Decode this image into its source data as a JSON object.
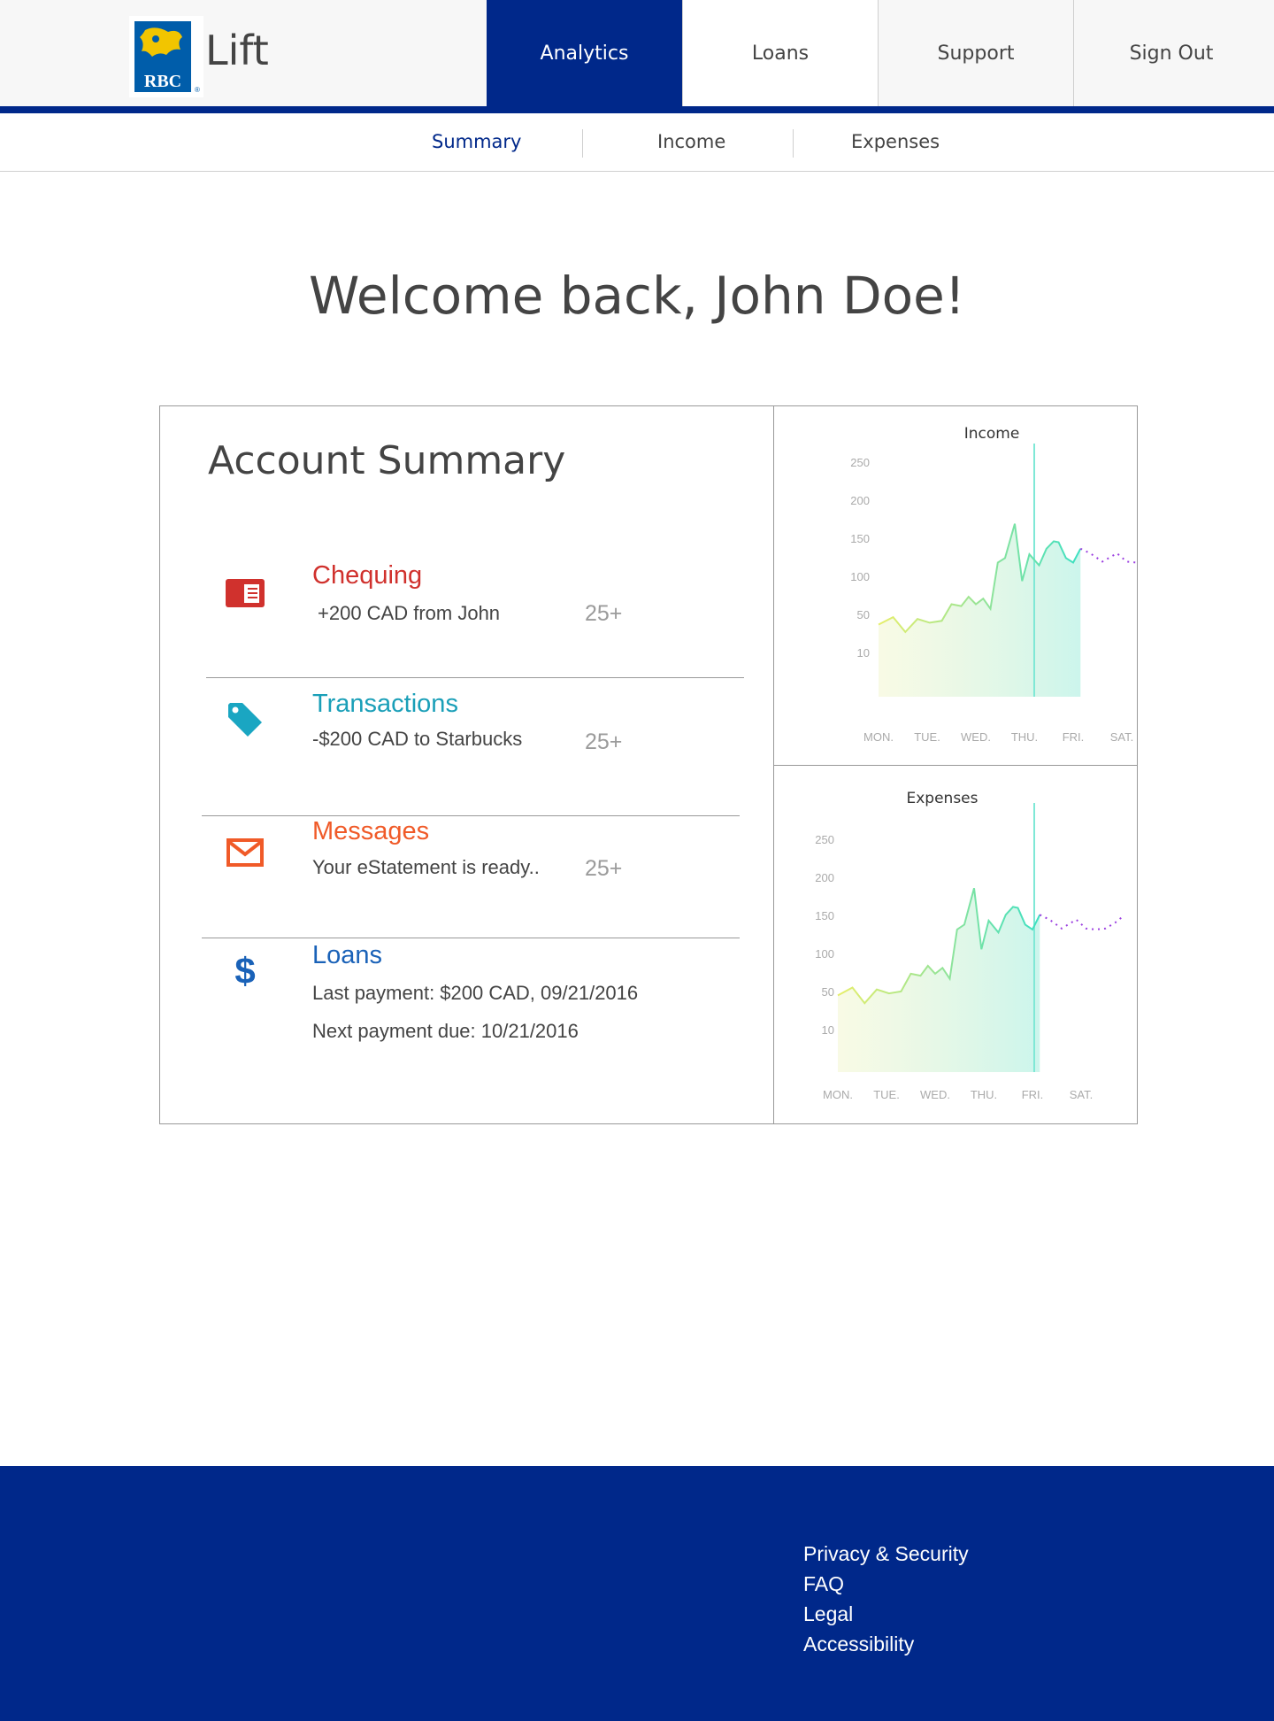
{
  "header": {
    "logo_text": "RBC",
    "brand": "Lift",
    "nav": [
      {
        "label": "Analytics"
      },
      {
        "label": "Loans"
      },
      {
        "label": "Support"
      },
      {
        "label": "Sign Out"
      }
    ],
    "accent_color": "#00288a"
  },
  "subnav": {
    "items": [
      {
        "label": "Summary"
      },
      {
        "label": "Income"
      },
      {
        "label": "Expenses"
      }
    ]
  },
  "welcome": "Welcome back, John Doe!",
  "summary": {
    "title": "Account Summary",
    "accounts": [
      {
        "title": "Chequing",
        "detail": "+200 CAD from John",
        "count": "25+",
        "icon": "card-icon",
        "color": "#d0312d"
      },
      {
        "title": "Transactions",
        "detail": "-$200 CAD to Starbucks",
        "count": "25+",
        "icon": "tag-icon",
        "color": "#1aa6c2"
      },
      {
        "title": "Messages",
        "detail": "Your eStatement is ready..",
        "count": "25+",
        "icon": "mail-icon",
        "color": "#f05a28"
      },
      {
        "title": "Loans",
        "detail": "Last payment: $200 CAD, 09/21/2016",
        "detail2": "Next payment due: 10/21/2016",
        "icon": "dollar-icon",
        "color": "#1a62b8"
      }
    ]
  },
  "chart_data": [
    {
      "type": "line",
      "title": "Income",
      "x_labels": [
        "MON.",
        "TUE.",
        "WED.",
        "THU.",
        "FRI.",
        "SAT."
      ],
      "y_ticks": [
        "250",
        "200",
        "150",
        "100",
        "50",
        "10"
      ],
      "x": [
        0.0,
        0.3,
        0.55,
        0.8,
        1.05,
        1.3,
        1.5,
        1.7,
        1.85,
        2.0,
        2.15,
        2.3,
        2.45,
        2.6,
        2.8,
        2.95,
        3.1,
        3.3,
        3.45,
        3.6,
        3.7,
        3.85,
        4.0,
        4.15,
        4.35,
        4.6,
        4.9,
        5.1,
        5.3,
        5.5,
        5.7,
        5.85
      ],
      "values": [
        78,
        86,
        70,
        84,
        80,
        82,
        100,
        98,
        108,
        100,
        106,
        95,
        145,
        150,
        187,
        125,
        154,
        142,
        160,
        168,
        167,
        150,
        145,
        160,
        155,
        146,
        155,
        146,
        145,
        146,
        152,
        158
      ],
      "forecast_from_index": 24,
      "ylim": [
        0,
        260
      ]
    },
    {
      "type": "line",
      "title": "Expenses",
      "x_labels": [
        "MON.",
        "TUE.",
        "WED.",
        "THU.",
        "FRI.",
        "SAT."
      ],
      "y_ticks": [
        "250",
        "200",
        "150",
        "100",
        "50",
        "10"
      ],
      "x": [
        0.0,
        0.3,
        0.55,
        0.8,
        1.05,
        1.3,
        1.5,
        1.7,
        1.85,
        2.0,
        2.15,
        2.3,
        2.45,
        2.6,
        2.8,
        2.95,
        3.1,
        3.3,
        3.45,
        3.6,
        3.7,
        3.85,
        4.0,
        4.15,
        4.35,
        4.6,
        4.9,
        5.1,
        5.3,
        5.5,
        5.7,
        5.85
      ],
      "values": [
        78,
        86,
        70,
        84,
        80,
        82,
        100,
        98,
        108,
        100,
        106,
        95,
        145,
        150,
        187,
        125,
        154,
        142,
        160,
        168,
        167,
        150,
        145,
        160,
        155,
        146,
        155,
        146,
        145,
        146,
        152,
        158
      ],
      "forecast_from_index": 24,
      "ylim": [
        0,
        260
      ]
    }
  ],
  "footer": {
    "links": [
      "Privacy & Security",
      "FAQ",
      "Legal",
      "Accessibility"
    ]
  }
}
